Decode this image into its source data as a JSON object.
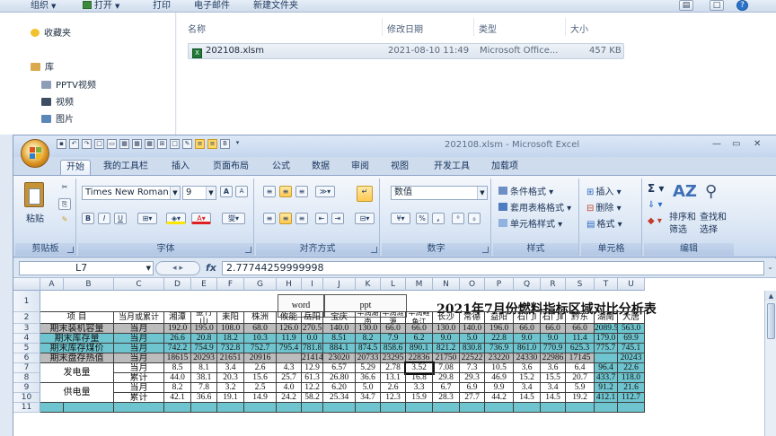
{
  "explorer": {
    "toolbar": {
      "organize": "组织",
      "open": "打开",
      "print": "打印",
      "email": "电子邮件",
      "new_folder": "新建文件夹"
    },
    "nav": {
      "favorites": "收藏夹",
      "library": "库",
      "pptv": "PPTV视频",
      "video": "视频",
      "pictures": "图片"
    },
    "columns": {
      "name": "名称",
      "modified": "修改日期",
      "type": "类型",
      "size": "大小"
    },
    "file": {
      "name": "202108.xlsm",
      "modified": "2021-08-10 11:49",
      "type": "Microsoft Office...",
      "size": "457 KB"
    }
  },
  "excel": {
    "title": "202108.xlsm - Microsoft Excel",
    "tabs": [
      "开始",
      "我的工具栏",
      "插入",
      "页面布局",
      "公式",
      "数据",
      "审阅",
      "视图",
      "开发工具",
      "加载项"
    ],
    "ribbon": {
      "clipboard": {
        "label": "剪贴板",
        "paste": "粘贴"
      },
      "font": {
        "label": "字体",
        "font_name": "Times New Roman",
        "font_size": "9",
        "bold": "B",
        "italic": "I",
        "underline": "U",
        "grow": "A",
        "shrink": "A"
      },
      "alignment": {
        "label": "对齐方式"
      },
      "number": {
        "label": "数字",
        "format": "数值",
        "percent": "%",
        "comma": ","
      },
      "styles": {
        "label": "样式",
        "conditional": "条件格式",
        "table": "套用表格格式",
        "cell": "单元格样式"
      },
      "cells": {
        "label": "单元格",
        "insert": "插入",
        "delete": "删除",
        "format": "格式"
      },
      "editing": {
        "label": "编辑",
        "sort": "排序和",
        "sort2": "筛选",
        "find": "查找和",
        "find2": "选择",
        "sum": "Σ"
      }
    },
    "formula_bar": {
      "cell_ref": "L7",
      "fx": "fx",
      "value": "2.77744259999998"
    },
    "columns": [
      "A",
      "B",
      "C",
      "D",
      "E",
      "F",
      "G",
      "H",
      "I",
      "J",
      "K",
      "L",
      "M",
      "N",
      "O",
      "P",
      "Q",
      "R",
      "S",
      "T",
      "U"
    ],
    "rows": [
      "1",
      "2",
      "3",
      "4",
      "5",
      "6",
      "7",
      "8",
      "9",
      "10",
      "11"
    ],
    "sheet": {
      "buttons": {
        "word": "word",
        "ppt": "ppt"
      },
      "title": "2021年7月份燃料指标区域对比分析表",
      "headers": {
        "item": "项  目",
        "period": "当月或累计",
        "plants": [
          "湘潭",
          "金竹山",
          "耒阳",
          "株洲",
          "攸能",
          "岳阳",
          "宝庆",
          "华润湖南",
          "华润涟源",
          "华润鲤鱼江",
          "长沙",
          "常德",
          "益阳",
          "石门Ⅰ",
          "石门Ⅱ",
          "黔东",
          "湖南",
          "大唐"
        ]
      },
      "rows": [
        {
          "label": "期末装机容量",
          "period": "当月",
          "values": [
            "192.0",
            "195.0",
            "108.0",
            "68.0",
            "126.0",
            "270.5",
            "140.0",
            "130.0",
            "66.0",
            "66.0",
            "130.0",
            "140.0",
            "196.0",
            "66.0",
            "66.0",
            "66.0",
            "2089.5",
            "563.0"
          ]
        },
        {
          "label": "期末库存量",
          "period": "当月",
          "values": [
            "26.6",
            "20.8",
            "18.2",
            "10.3",
            "11.9",
            "0.0",
            "8.51",
            "8.2",
            "7.9",
            "6.2",
            "9.0",
            "5.0",
            "22.8",
            "9.0",
            "9.0",
            "11.4",
            "179.0",
            "69.9"
          ]
        },
        {
          "label": "期末库存煤价",
          "period": "当月",
          "values": [
            "742.2",
            "754.9",
            "732.8",
            "752.7",
            "795.4",
            "781.8",
            "884.1",
            "874.5",
            "858.6",
            "890.1",
            "821.2",
            "830.8",
            "736.9",
            "861.0",
            "770.9",
            "625.3",
            "775.7",
            "745.1"
          ]
        },
        {
          "label": "期末盘存热值",
          "period": "当月",
          "values": [
            "18615",
            "20293",
            "21651",
            "20916",
            "",
            "21414",
            "23020",
            "20733",
            "23295",
            "22836",
            "21750",
            "22522",
            "23220",
            "24330",
            "22986",
            "17145",
            "",
            "20243"
          ]
        },
        {
          "label": "发电量",
          "period": "当月",
          "values": [
            "8.5",
            "8.1",
            "3.4",
            "2.6",
            "4.3",
            "12.9",
            "6.57",
            "5.29",
            "2.78",
            "3.52",
            "7.08",
            "7.3",
            "10.5",
            "3.6",
            "3.6",
            "6.4",
            "96.4",
            "22.6"
          ]
        },
        {
          "label": "",
          "period": "累计",
          "values": [
            "44.0",
            "38.1",
            "20.3",
            "15.6",
            "25.7",
            "61.3",
            "26.80",
            "36.6",
            "13.1",
            "16.8",
            "29.8",
            "29.3",
            "46.9",
            "15.2",
            "15.5",
            "20.7",
            "433.7",
            "118.0"
          ]
        },
        {
          "label": "供电量",
          "period": "当月",
          "values": [
            "8.2",
            "7.8",
            "3.2",
            "2.5",
            "4.0",
            "12.2",
            "6.20",
            "5.0",
            "2.6",
            "3.3",
            "6.7",
            "6.9",
            "9.9",
            "3.4",
            "3.4",
            "5.9",
            "91.2",
            "21.6"
          ]
        },
        {
          "label": "",
          "period": "累计",
          "values": [
            "42.1",
            "36.6",
            "19.1",
            "14.9",
            "24.2",
            "58.2",
            "25.34",
            "34.7",
            "12.3",
            "15.9",
            "28.3",
            "27.7",
            "44.2",
            "14.5",
            "14.5",
            "19.2",
            "412.1",
            "112.7"
          ]
        }
      ]
    }
  }
}
